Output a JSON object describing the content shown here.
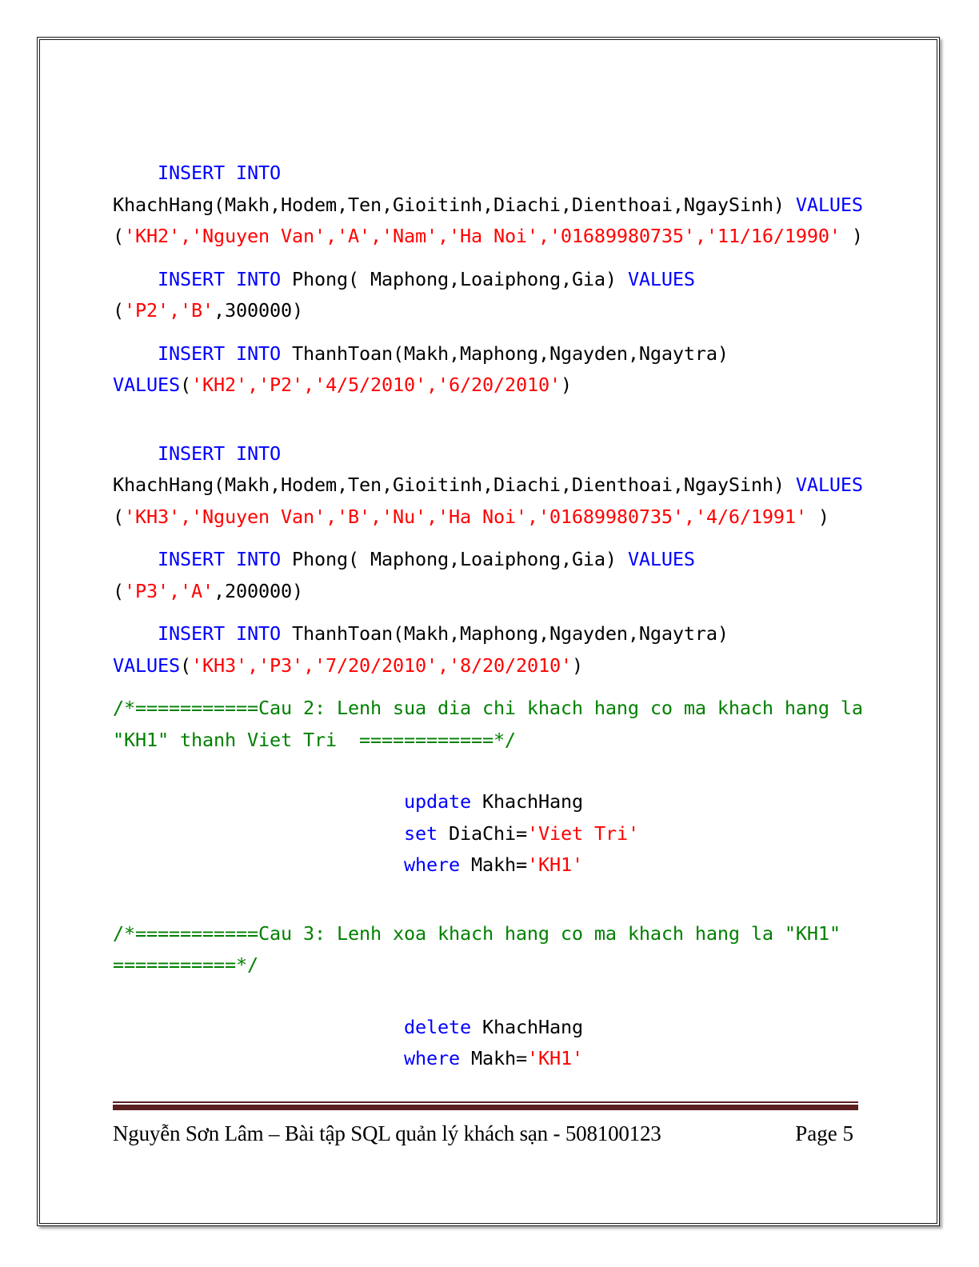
{
  "document": {
    "page_label": "Page 5",
    "footer_author_line": "Nguyễn Sơn Lâm – Bài tập SQL quản lý khách sạn - 508100123",
    "colors": {
      "keyword": "#0000FF",
      "string": "#FF0000",
      "comment": "#008000",
      "text": "#000000",
      "footer_rule": "#5B2020",
      "page_border": "#1A1A1A",
      "background": "#FFFFFF"
    }
  },
  "code": {
    "blocks": [
      {
        "id": "insert-khachhang-kh2",
        "lines": [
          [
            {
              "t": "    ",
              "c": "plain"
            },
            {
              "t": "INSERT INTO",
              "c": "kw"
            },
            {
              "t": " ",
              "c": "plain"
            }
          ],
          [
            {
              "t": "KhachHang(Makh,Hodem,Ten,Gioitinh,Diachi,Dienthoai,NgaySinh) ",
              "c": "plain"
            },
            {
              "t": "VALUES",
              "c": "kw"
            },
            {
              "t": " (",
              "c": "plain"
            },
            {
              "t": "'KH2','Nguyen Van','A','Nam','Ha Noi','01689980735','11/16/1990'",
              "c": "str"
            },
            {
              "t": " )",
              "c": "plain"
            }
          ]
        ]
      },
      {
        "id": "insert-phong-p2",
        "lines": [
          [
            {
              "t": "    ",
              "c": "plain"
            },
            {
              "t": "INSERT INTO",
              "c": "kw"
            },
            {
              "t": " Phong( Maphong,Loaiphong,Gia) ",
              "c": "plain"
            },
            {
              "t": "VALUES",
              "c": "kw"
            },
            {
              "t": " (",
              "c": "plain"
            },
            {
              "t": "'P2','B'",
              "c": "str"
            },
            {
              "t": ",300000)",
              "c": "plain"
            }
          ]
        ]
      },
      {
        "id": "insert-thanhtoan-kh2",
        "lines": [
          [
            {
              "t": "    ",
              "c": "plain"
            },
            {
              "t": "INSERT INTO",
              "c": "kw"
            },
            {
              "t": " ThanhToan(Makh,Maphong,Ngayden,Ngaytra) ",
              "c": "plain"
            },
            {
              "t": "VALUES",
              "c": "kw"
            },
            {
              "t": "(",
              "c": "plain"
            },
            {
              "t": "'KH2','P2','4/5/2010','6/20/2010'",
              "c": "str"
            },
            {
              "t": ")",
              "c": "plain"
            }
          ]
        ]
      },
      {
        "id": "insert-khachhang-kh3",
        "lines": [
          [
            {
              "t": "    ",
              "c": "plain"
            },
            {
              "t": "INSERT INTO",
              "c": "kw"
            },
            {
              "t": " ",
              "c": "plain"
            }
          ],
          [
            {
              "t": "KhachHang(Makh,Hodem,Ten,Gioitinh,Diachi,Dienthoai,NgaySinh) ",
              "c": "plain"
            },
            {
              "t": "VALUES",
              "c": "kw"
            },
            {
              "t": " (",
              "c": "plain"
            },
            {
              "t": "'KH3','Nguyen Van','B','Nu','Ha Noi','01689980735','4/6/1991'",
              "c": "str"
            },
            {
              "t": " )",
              "c": "plain"
            }
          ]
        ]
      },
      {
        "id": "insert-phong-p3",
        "lines": [
          [
            {
              "t": "    ",
              "c": "plain"
            },
            {
              "t": "INSERT INTO",
              "c": "kw"
            },
            {
              "t": " Phong( Maphong,Loaiphong,Gia) ",
              "c": "plain"
            },
            {
              "t": "VALUES",
              "c": "kw"
            },
            {
              "t": " (",
              "c": "plain"
            },
            {
              "t": "'P3','A'",
              "c": "str"
            },
            {
              "t": ",200000)",
              "c": "plain"
            }
          ]
        ]
      },
      {
        "id": "insert-thanhtoan-kh3",
        "lines": [
          [
            {
              "t": "    ",
              "c": "plain"
            },
            {
              "t": "INSERT INTO",
              "c": "kw"
            },
            {
              "t": " ThanhToan(Makh,Maphong,Ngayden,Ngaytra) ",
              "c": "plain"
            },
            {
              "t": "VALUES",
              "c": "kw"
            },
            {
              "t": "(",
              "c": "plain"
            },
            {
              "t": "'KH3','P3','7/20/2010','8/20/2010'",
              "c": "str"
            },
            {
              "t": ")",
              "c": "plain"
            }
          ]
        ]
      },
      {
        "id": "comment-cau-2",
        "lines": [
          [
            {
              "t": "/*===========Cau 2: Lenh sua dia chi khach hang co ma khach hang la \"KH1\" thanh Viet Tri  ============*/",
              "c": "cmt"
            }
          ]
        ]
      },
      {
        "id": "update-khachhang",
        "lines": [
          [
            {
              "t": "                          ",
              "c": "plain"
            },
            {
              "t": "update",
              "c": "kw"
            },
            {
              "t": " KhachHang",
              "c": "plain"
            }
          ],
          [
            {
              "t": "                          ",
              "c": "plain"
            },
            {
              "t": "set",
              "c": "kw"
            },
            {
              "t": " DiaChi=",
              "c": "plain"
            },
            {
              "t": "'Viet Tri'",
              "c": "str"
            }
          ],
          [
            {
              "t": "                          ",
              "c": "plain"
            },
            {
              "t": "where",
              "c": "kw"
            },
            {
              "t": " Makh=",
              "c": "plain"
            },
            {
              "t": "'KH1'",
              "c": "str"
            }
          ]
        ]
      },
      {
        "id": "comment-cau-3",
        "lines": [
          [
            {
              "t": "/*===========Cau 3: Lenh xoa khach hang co ma khach hang la \"KH1\"  ===========*/",
              "c": "cmt"
            }
          ]
        ]
      },
      {
        "id": "delete-khachhang",
        "lines": [
          [
            {
              "t": "                          ",
              "c": "plain"
            },
            {
              "t": "delete",
              "c": "kw"
            },
            {
              "t": " KhachHang",
              "c": "plain"
            }
          ],
          [
            {
              "t": "                          ",
              "c": "plain"
            },
            {
              "t": "where",
              "c": "kw"
            },
            {
              "t": " Makh=",
              "c": "plain"
            },
            {
              "t": "'KH1'",
              "c": "str"
            }
          ]
        ]
      }
    ]
  }
}
